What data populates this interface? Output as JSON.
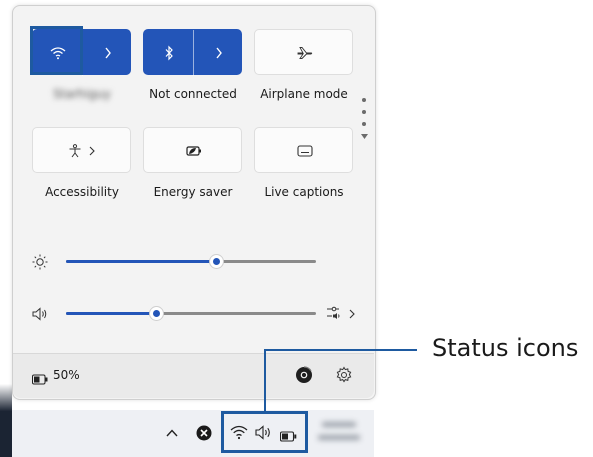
{
  "panel": {
    "tiles": [
      {
        "id": "wifi",
        "label": "Starhiguy",
        "state": "on",
        "icon": "wifi-icon",
        "has_chevron": true
      },
      {
        "id": "bluetooth",
        "label": "Not connected",
        "state": "on",
        "icon": "bluetooth-icon",
        "has_chevron": true
      },
      {
        "id": "airplane",
        "label": "Airplane mode",
        "state": "off",
        "icon": "airplane-icon",
        "has_chevron": false
      },
      {
        "id": "accessibility",
        "label": "Accessibility",
        "state": "off",
        "icon": "accessibility-icon",
        "has_chevron": true
      },
      {
        "id": "energy",
        "label": "Energy saver",
        "state": "off",
        "icon": "energy-saver-icon",
        "has_chevron": false
      },
      {
        "id": "captions",
        "label": "Live captions",
        "state": "off",
        "icon": "captions-icon",
        "has_chevron": false
      }
    ],
    "brightness": {
      "icon": "brightness-icon",
      "level": 0.6
    },
    "volume": {
      "icon": "speaker-icon",
      "level": 0.36,
      "mixer_icon": "audio-mixer-icon"
    },
    "battery": {
      "icon": "battery-icon",
      "percent_label": "50%"
    },
    "footer_icons": [
      "chrome-icon",
      "gear-icon"
    ]
  },
  "taskbar": {
    "icons": [
      "chevron-up-icon",
      "close-icon",
      "wifi-icon",
      "speaker-icon",
      "battery-icon"
    ],
    "clock_blurred": true
  },
  "annotation": {
    "label": "Status icons"
  },
  "colors": {
    "accent": "#2355b8",
    "highlight": "#1e5aa0",
    "panel_bg": "#f3f3f3"
  }
}
